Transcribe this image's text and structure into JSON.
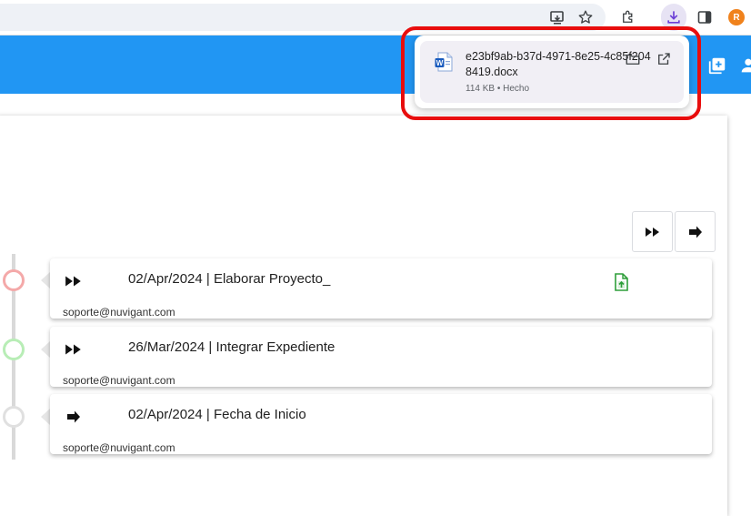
{
  "browser": {
    "avatar_initial": "R",
    "icons": [
      "cast-icon",
      "star-icon",
      "extensions-icon",
      "download-icon",
      "side-panel-icon"
    ]
  },
  "header": {
    "icons": [
      "add-box-icon",
      "account-icon"
    ],
    "color": "#2196f3"
  },
  "controls": {
    "icons": [
      "fast-forward-icon",
      "arrow-right-icon"
    ]
  },
  "timeline": {
    "entries": [
      {
        "title": "02/Apr/2024 | Elaborar Proyecto_",
        "user": "soporte@nuvigant.com",
        "type_icon": "fast-forward-icon",
        "status_color": "#f4a9a9",
        "has_file": true
      },
      {
        "title": "26/Mar/2024 | Integrar Expediente",
        "user": "soporte@nuvigant.com",
        "type_icon": "fast-forward-icon",
        "status_color": "#b8edb6",
        "has_file": false
      },
      {
        "title": "02/Apr/2024 | Fecha de Inicio",
        "user": "soporte@nuvigant.com",
        "type_icon": "arrow-right-icon",
        "status_color": "#e0e0e0",
        "has_file": false
      }
    ]
  },
  "download": {
    "filename": "e23bf9ab-b37d-4971-8e25-4c85f2048419.docx",
    "status": "114 KB • Hecho",
    "highlight_color": "#e80d0d"
  }
}
